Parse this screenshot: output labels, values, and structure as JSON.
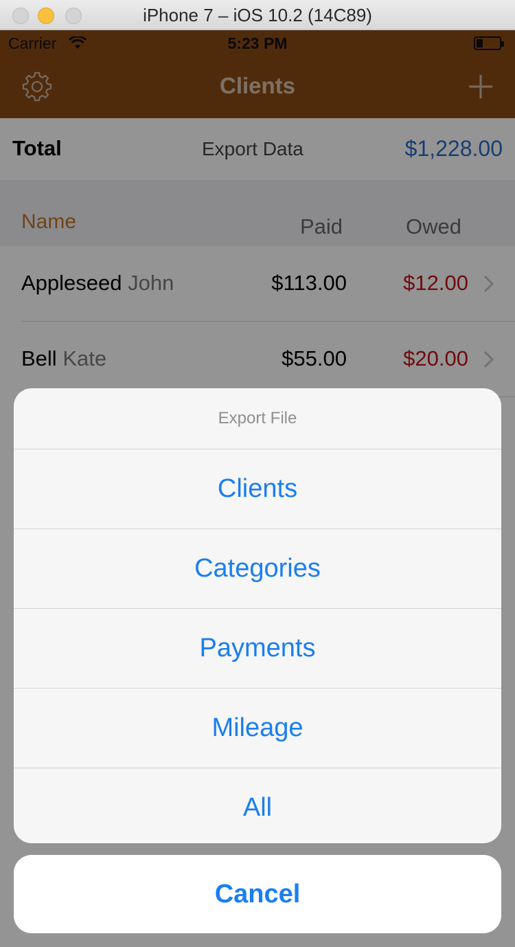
{
  "window": {
    "title": "iPhone 7 – iOS 10.2 (14C89)"
  },
  "status_bar": {
    "carrier": "Carrier",
    "time": "5:23 PM",
    "wifi_icon": "wifi-icon",
    "battery_icon": "battery-icon",
    "battery_level": 0.2
  },
  "navbar": {
    "title": "Clients",
    "settings_icon": "gear-icon",
    "add_icon": "plus-icon",
    "color": "#8b4a14"
  },
  "summary": {
    "total_label": "Total",
    "export_label": "Export Data",
    "total_amount": "$1,228.00"
  },
  "table": {
    "headers": {
      "name": "Name",
      "paid": "Paid",
      "owed": "Owed"
    },
    "rows": [
      {
        "last": "Appleseed",
        "first": "John",
        "paid": "$113.00",
        "owed": "$12.00"
      },
      {
        "last": "Bell",
        "first": "Kate",
        "paid": "$55.00",
        "owed": "$20.00"
      }
    ]
  },
  "action_sheet": {
    "title": "Export File",
    "options": [
      "Clients",
      "Categories",
      "Payments",
      "Mileage",
      "All"
    ],
    "cancel": "Cancel"
  },
  "colors": {
    "accent": "#1a7ef0",
    "owed": "#c2141c",
    "total": "#2a6ac8",
    "header": "#c0752b"
  }
}
